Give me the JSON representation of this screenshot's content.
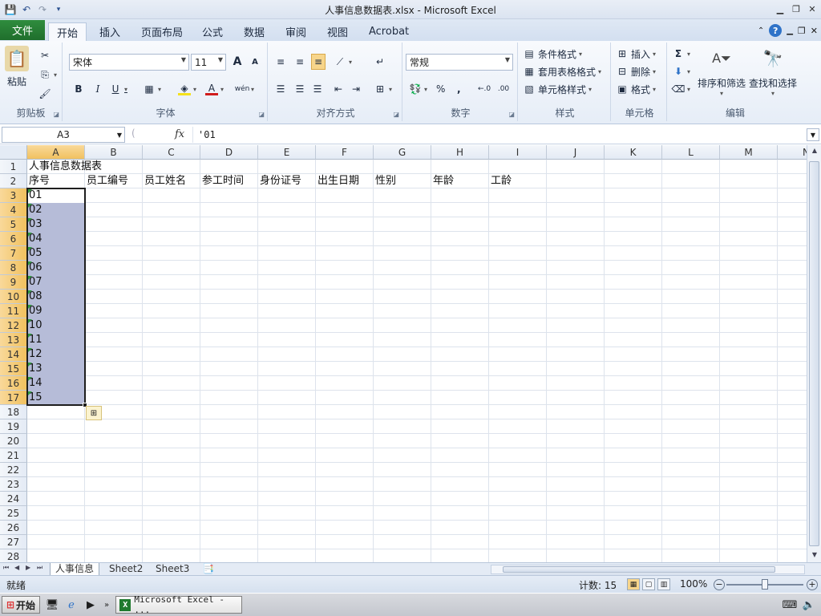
{
  "titlebar": {
    "title": "人事信息数据表.xlsx  -  Microsoft Excel",
    "qat": [
      "save-icon",
      "undo-icon",
      "redo-icon",
      "customize-qat-icon"
    ]
  },
  "ribbon_tabs": [
    "文件",
    "开始",
    "插入",
    "页面布局",
    "公式",
    "数据",
    "审阅",
    "视图",
    "Acrobat"
  ],
  "active_tab": "开始",
  "ribbon": {
    "clipboard": {
      "label": "剪贴板",
      "paste": "粘贴"
    },
    "font": {
      "label": "字体",
      "font_name": "宋体",
      "font_size": "11"
    },
    "alignment": {
      "label": "对齐方式"
    },
    "number": {
      "label": "数字",
      "format": "常规",
      "percent": "%",
      "comma": ","
    },
    "styles": {
      "label": "样式",
      "conditional": "条件格式",
      "table": "套用表格格式",
      "cell_styles": "单元格样式"
    },
    "cells": {
      "label": "单元格",
      "insert": "插入",
      "delete": "删除",
      "format": "格式"
    },
    "editing": {
      "label": "编辑",
      "sort": "排序和筛选",
      "find": "查找和选择"
    }
  },
  "formula_bar": {
    "name_box": "A3",
    "fx": "fx",
    "content": "'01"
  },
  "columns": [
    "A",
    "B",
    "C",
    "D",
    "E",
    "F",
    "G",
    "H",
    "I",
    "J",
    "K",
    "L",
    "M",
    "N"
  ],
  "rows": [
    "1",
    "2",
    "3",
    "4",
    "5",
    "6",
    "7",
    "8",
    "9",
    "10",
    "11",
    "12",
    "13",
    "14",
    "15",
    "16",
    "17",
    "18",
    "19",
    "20",
    "21",
    "22",
    "23",
    "24",
    "25",
    "26",
    "27",
    "28"
  ],
  "cells": {
    "title": "人事信息数据表",
    "headers": [
      "序号",
      "员工编号",
      "员工姓名",
      "参工时间",
      "身份证号",
      "出生日期",
      "性别",
      "年龄",
      "工龄"
    ],
    "serials": [
      "01",
      "02",
      "03",
      "04",
      "05",
      "06",
      "07",
      "08",
      "09",
      "10",
      "11",
      "12",
      "13",
      "14",
      "15"
    ]
  },
  "sheets": [
    "人事信息",
    "Sheet2",
    "Sheet3"
  ],
  "active_sheet": "人事信息",
  "status": {
    "ready": "就绪",
    "count": "计数: 15",
    "zoom": "100%"
  },
  "taskbar": {
    "start": "开始",
    "task": "Microsoft Excel - ..."
  },
  "colors": {
    "selection": "#b6bcd8",
    "header_selected": "#f1c15f",
    "file_tab": "#1f6e2c"
  }
}
